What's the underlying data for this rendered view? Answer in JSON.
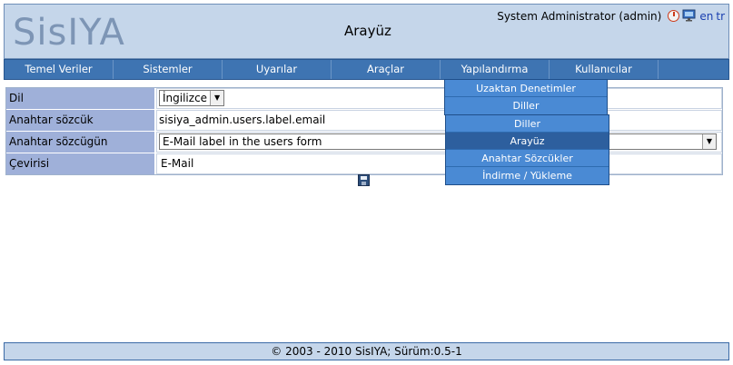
{
  "app": {
    "logo_text": "SisIYA",
    "page_title": "Arayüz"
  },
  "user": {
    "name": "System Administrator (admin)",
    "lang_en": "en",
    "lang_tr": "tr"
  },
  "menu": [
    {
      "label": "Temel Veriler"
    },
    {
      "label": "Sistemler"
    },
    {
      "label": "Uyarılar"
    },
    {
      "label": "Araçlar"
    },
    {
      "label": "Yapılandırma"
    },
    {
      "label": "Kullanıcılar"
    }
  ],
  "form": {
    "language": {
      "label": "Dil",
      "value": "İngilizce"
    },
    "keyword": {
      "label": "Anahtar sözcük",
      "value": "sisiya_admin.users.label.email"
    },
    "keyword_desc": {
      "label": "Anahtar sözcügün açıklaması",
      "value": "E-Mail label in the users form"
    },
    "translation": {
      "label": "Çevirisi",
      "value": "E-Mail"
    }
  },
  "config_menu": [
    {
      "label": "Uzaktan Denetimler"
    },
    {
      "label": "Diller"
    }
  ],
  "languages_submenu": [
    {
      "label": "Diller"
    },
    {
      "label": "Arayüz"
    },
    {
      "label": "Anahtar Sözcükler"
    },
    {
      "label": "İndirme / Yükleme"
    }
  ],
  "footer": {
    "text": "© 2003 - 2010 SisIYA; Sürüm:0.5-1"
  },
  "colors": {
    "header_bg": "#c5d6ea",
    "menu_bg": "#3e74b2",
    "dropdown_bg": "#4a8ad4",
    "label_bg": "#9fb0d9"
  }
}
